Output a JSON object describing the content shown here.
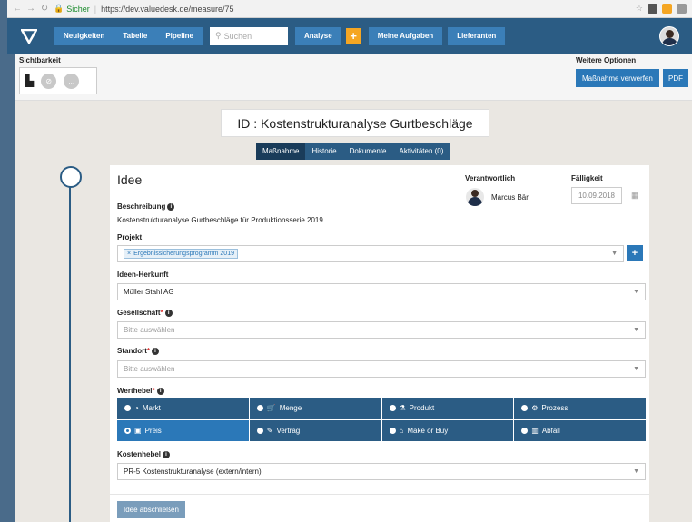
{
  "browser": {
    "secure_label": "Sicher",
    "url": "https://dev.valuedesk.de/measure/75"
  },
  "nav": {
    "items": [
      "Neuigkeiten",
      "Tabelle",
      "Pipeline"
    ],
    "search_placeholder": "Suchen",
    "analyse": "Analyse",
    "plus": "+",
    "aufgaben": "Meine Aufgaben",
    "lieferanten": "Lieferanten"
  },
  "toolbar": {
    "sichtbarkeit": "Sichtbarkeit",
    "weitere": "Weitere Optionen",
    "verwerfen": "Maßnahme verwerfen",
    "pdf": "PDF",
    "dots": "..."
  },
  "title": "ID : Kostenstrukturanalyse Gurtbeschläge",
  "tabs": [
    "Maßnahme",
    "Historie",
    "Dokumente",
    "Aktivitäten (0)"
  ],
  "card": {
    "heading": "Idee",
    "beschreibung_label": "Beschreibung",
    "beschreibung": "Kostenstrukturanalyse Gurtbeschläge für Produktionsserie 2019.",
    "projekt_label": "Projekt",
    "projekt_tag": "Ergebnissicherungsprogramm 2019",
    "herkunft_label": "Ideen-Herkunft",
    "herkunft": "Müller Stahl AG",
    "gesellschaft_label": "Gesellschaft",
    "gesellschaft_ph": "Bitte auswählen",
    "standort_label": "Standort",
    "standort_ph": "Bitte auswählen",
    "werthebel_label": "Werthebel",
    "werthebel": [
      {
        "label": "Markt",
        "icon": "gauge-icon",
        "glyph": "◔"
      },
      {
        "label": "Menge",
        "icon": "cart-icon",
        "glyph": "🛒"
      },
      {
        "label": "Produkt",
        "icon": "flask-icon",
        "glyph": "⚗"
      },
      {
        "label": "Prozess",
        "icon": "process-icon",
        "glyph": "⚙"
      },
      {
        "label": "Preis",
        "icon": "money-icon",
        "glyph": "▣"
      },
      {
        "label": "Vertrag",
        "icon": "contract-icon",
        "glyph": "✎"
      },
      {
        "label": "Make or Buy",
        "icon": "home-icon",
        "glyph": "⌂"
      },
      {
        "label": "Abfall",
        "icon": "trash-icon",
        "glyph": "▥"
      }
    ],
    "kostenhebel_label": "Kostenhebel",
    "kostenhebel": "PR-5 Kostenstrukturanalyse (extern/intern)",
    "verantwortlich_label": "Verantwortlich",
    "verantwortlich": "Marcus Bär",
    "faelligkeit_label": "Fälligkeit",
    "faelligkeit": "10.09.2018",
    "close_btn": "Idee abschließen"
  }
}
